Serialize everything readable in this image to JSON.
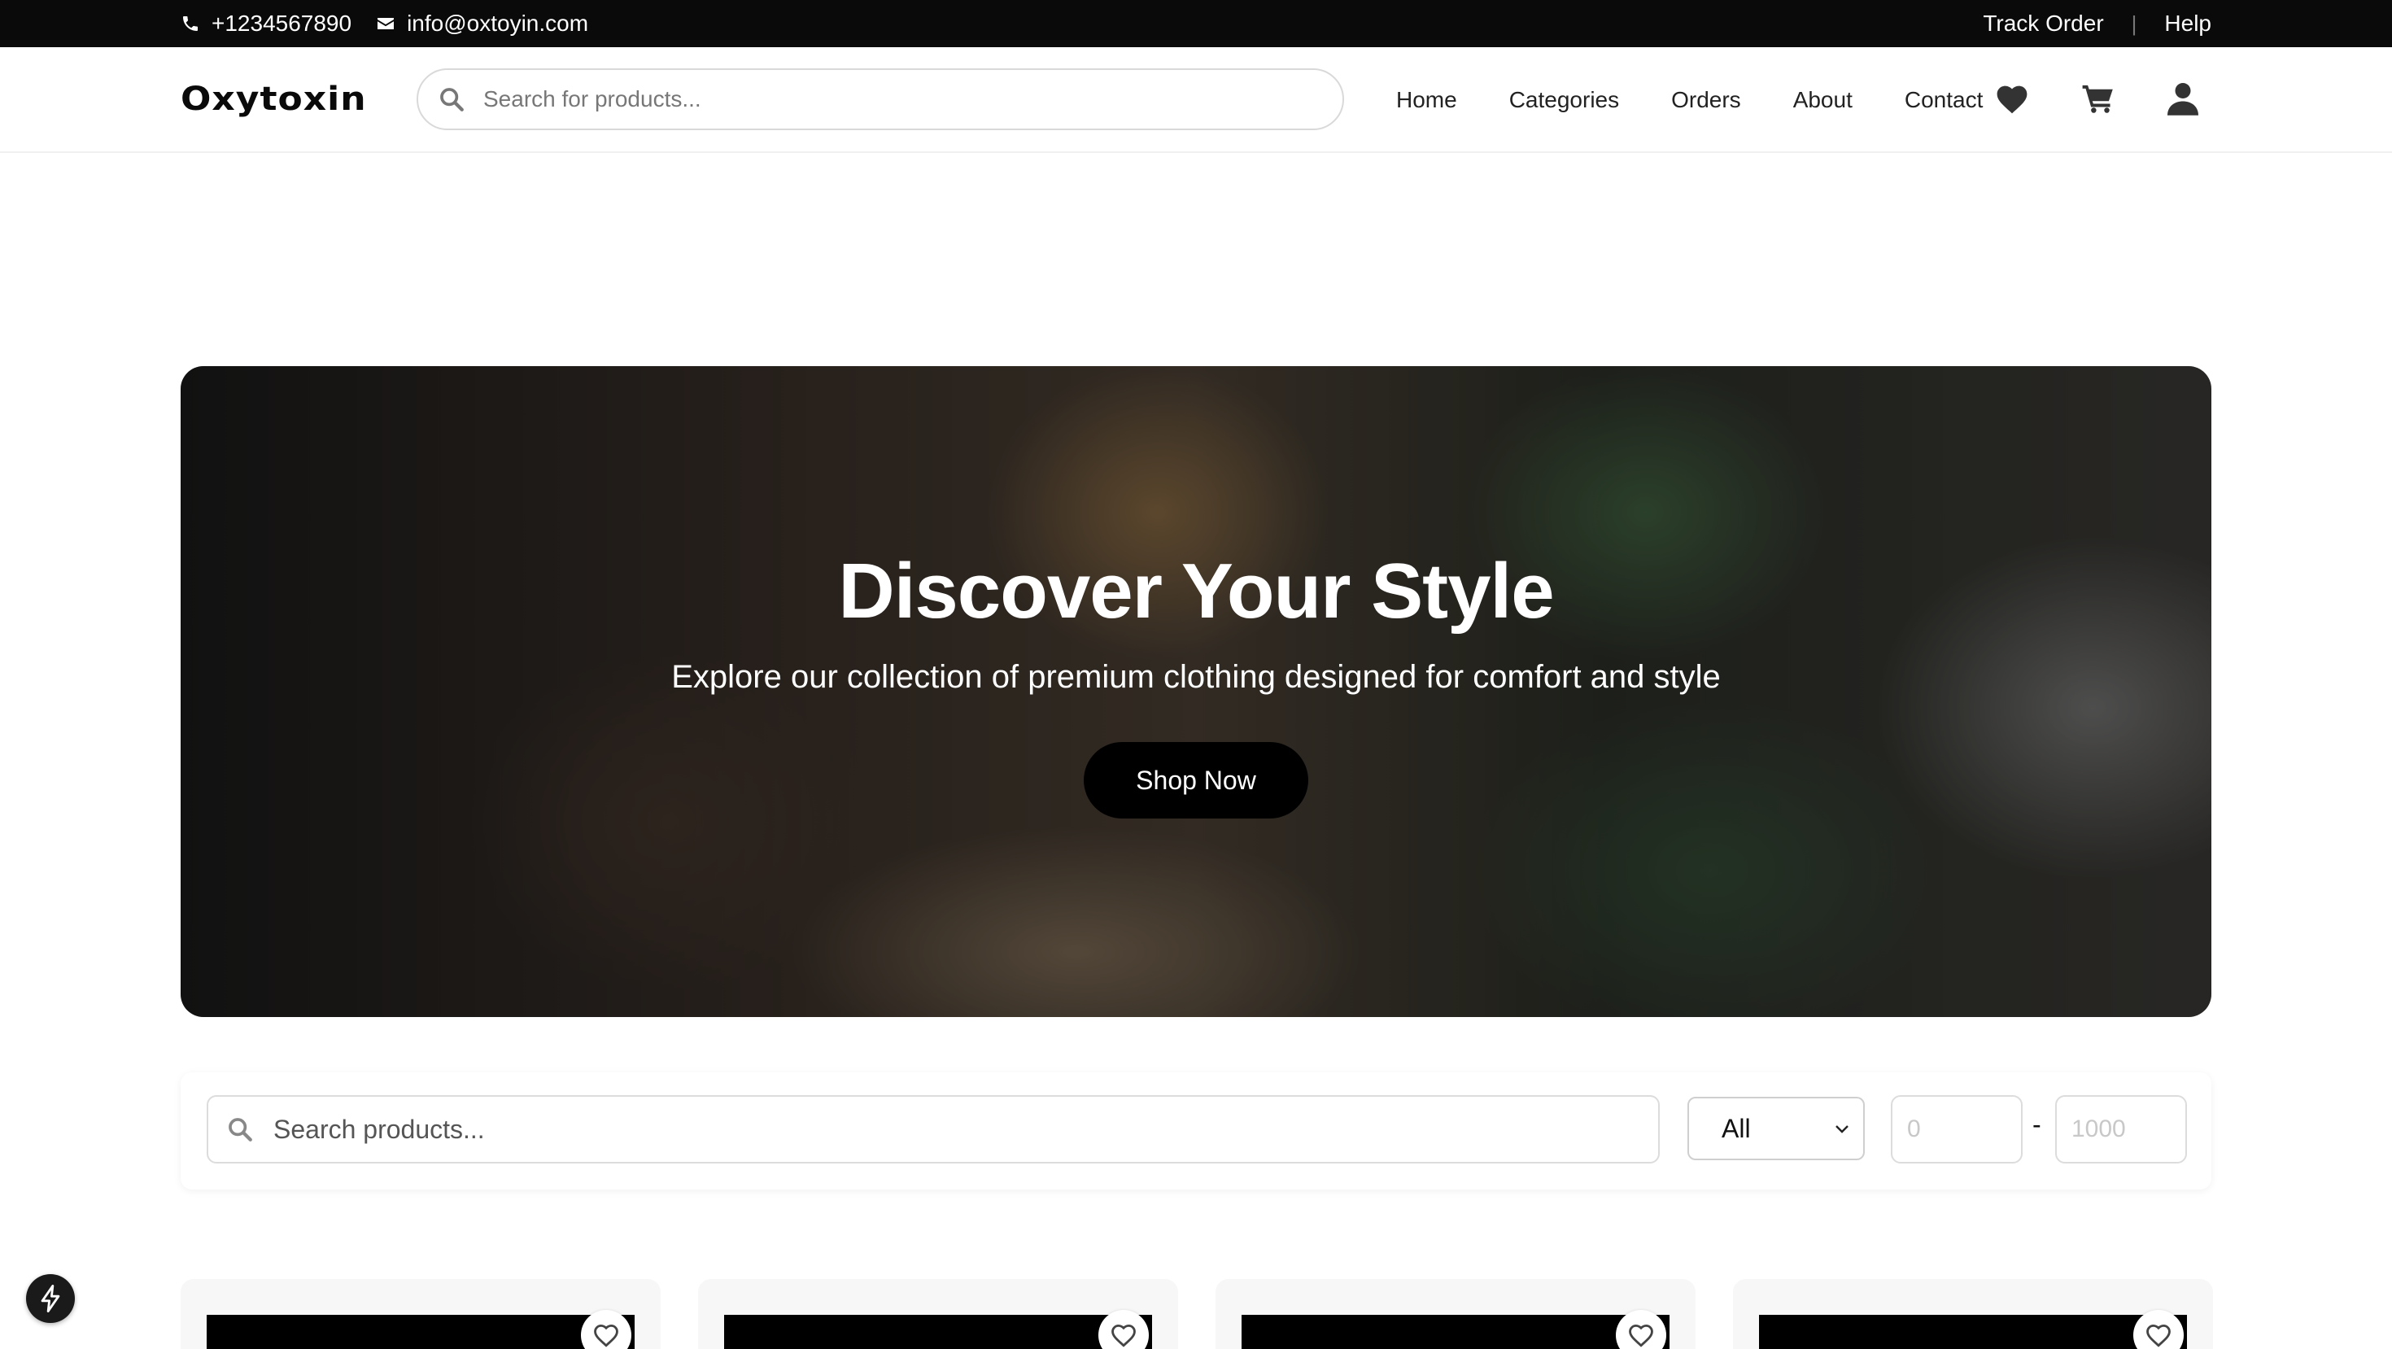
{
  "topbar": {
    "phone": "+1234567890",
    "email": "info@oxtoyin.com",
    "track_order": "Track Order",
    "separator": "|",
    "help": "Help"
  },
  "header": {
    "logo": "Oxytoxin",
    "search_placeholder": "Search for products...",
    "nav": [
      "Home",
      "Categories",
      "Orders",
      "About",
      "Contact"
    ],
    "icons": [
      "heart-icon",
      "cart-icon",
      "user-icon"
    ]
  },
  "hero": {
    "title": "Discover Your Style",
    "subtitle": "Explore our collection of premium clothing designed for comfort and style",
    "cta": "Shop Now"
  },
  "filter": {
    "search_placeholder": "Search products...",
    "category_selected": "All",
    "price_min_placeholder": "0",
    "price_max_placeholder": "1000",
    "range_separator": "-"
  },
  "products": [
    {
      "favorite": false
    },
    {
      "favorite": false
    },
    {
      "favorite": false
    },
    {
      "favorite": false
    }
  ],
  "colors": {
    "topbar_bg": "#0a0a0a",
    "primary_button": "#000000",
    "page_bg": "#ffffff"
  }
}
